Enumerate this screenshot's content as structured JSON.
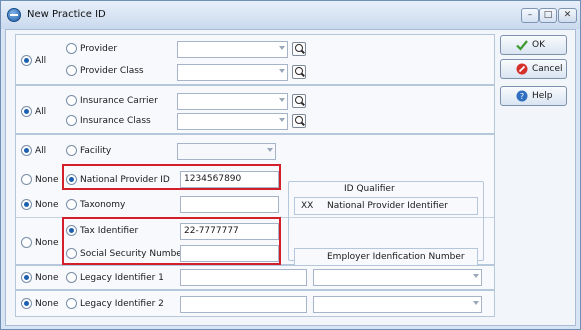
{
  "window": {
    "title": "New Practice ID",
    "min_glyph": "–",
    "max_glyph": "□",
    "close_glyph": "✕"
  },
  "rows": {
    "provider": {
      "all": "All",
      "provider": "Provider",
      "provider_class": "Provider Class"
    },
    "insurance": {
      "all": "All",
      "carrier": "Insurance Carrier",
      "class": "Insurance Class"
    },
    "facility": {
      "all": "All",
      "facility": "Facility"
    },
    "npi": {
      "none": "None",
      "label": "National Provider ID",
      "value": "1234567890"
    },
    "taxonomy": {
      "none": "None",
      "label": "Taxonomy",
      "value": ""
    },
    "tax": {
      "none": "None",
      "tax_label": "Tax Identifier",
      "tax_value": "22-7777777",
      "ssn_label": "Social Security Number",
      "ssn_value": ""
    },
    "legacy1": {
      "none": "None",
      "label": "Legacy Identifier 1",
      "value": ""
    },
    "legacy2": {
      "none": "None",
      "label": "Legacy Identifier 2",
      "value": ""
    }
  },
  "qualifier": {
    "title": "ID Qualifier",
    "code": "XX",
    "description": "National Provider Identifier",
    "second_description": "Employer Idenfication Number"
  },
  "buttons": {
    "ok": "OK",
    "cancel": "Cancel",
    "help": "Help"
  },
  "colors": {
    "highlight": "#d21f2a",
    "accent": "#1b5fb0"
  }
}
